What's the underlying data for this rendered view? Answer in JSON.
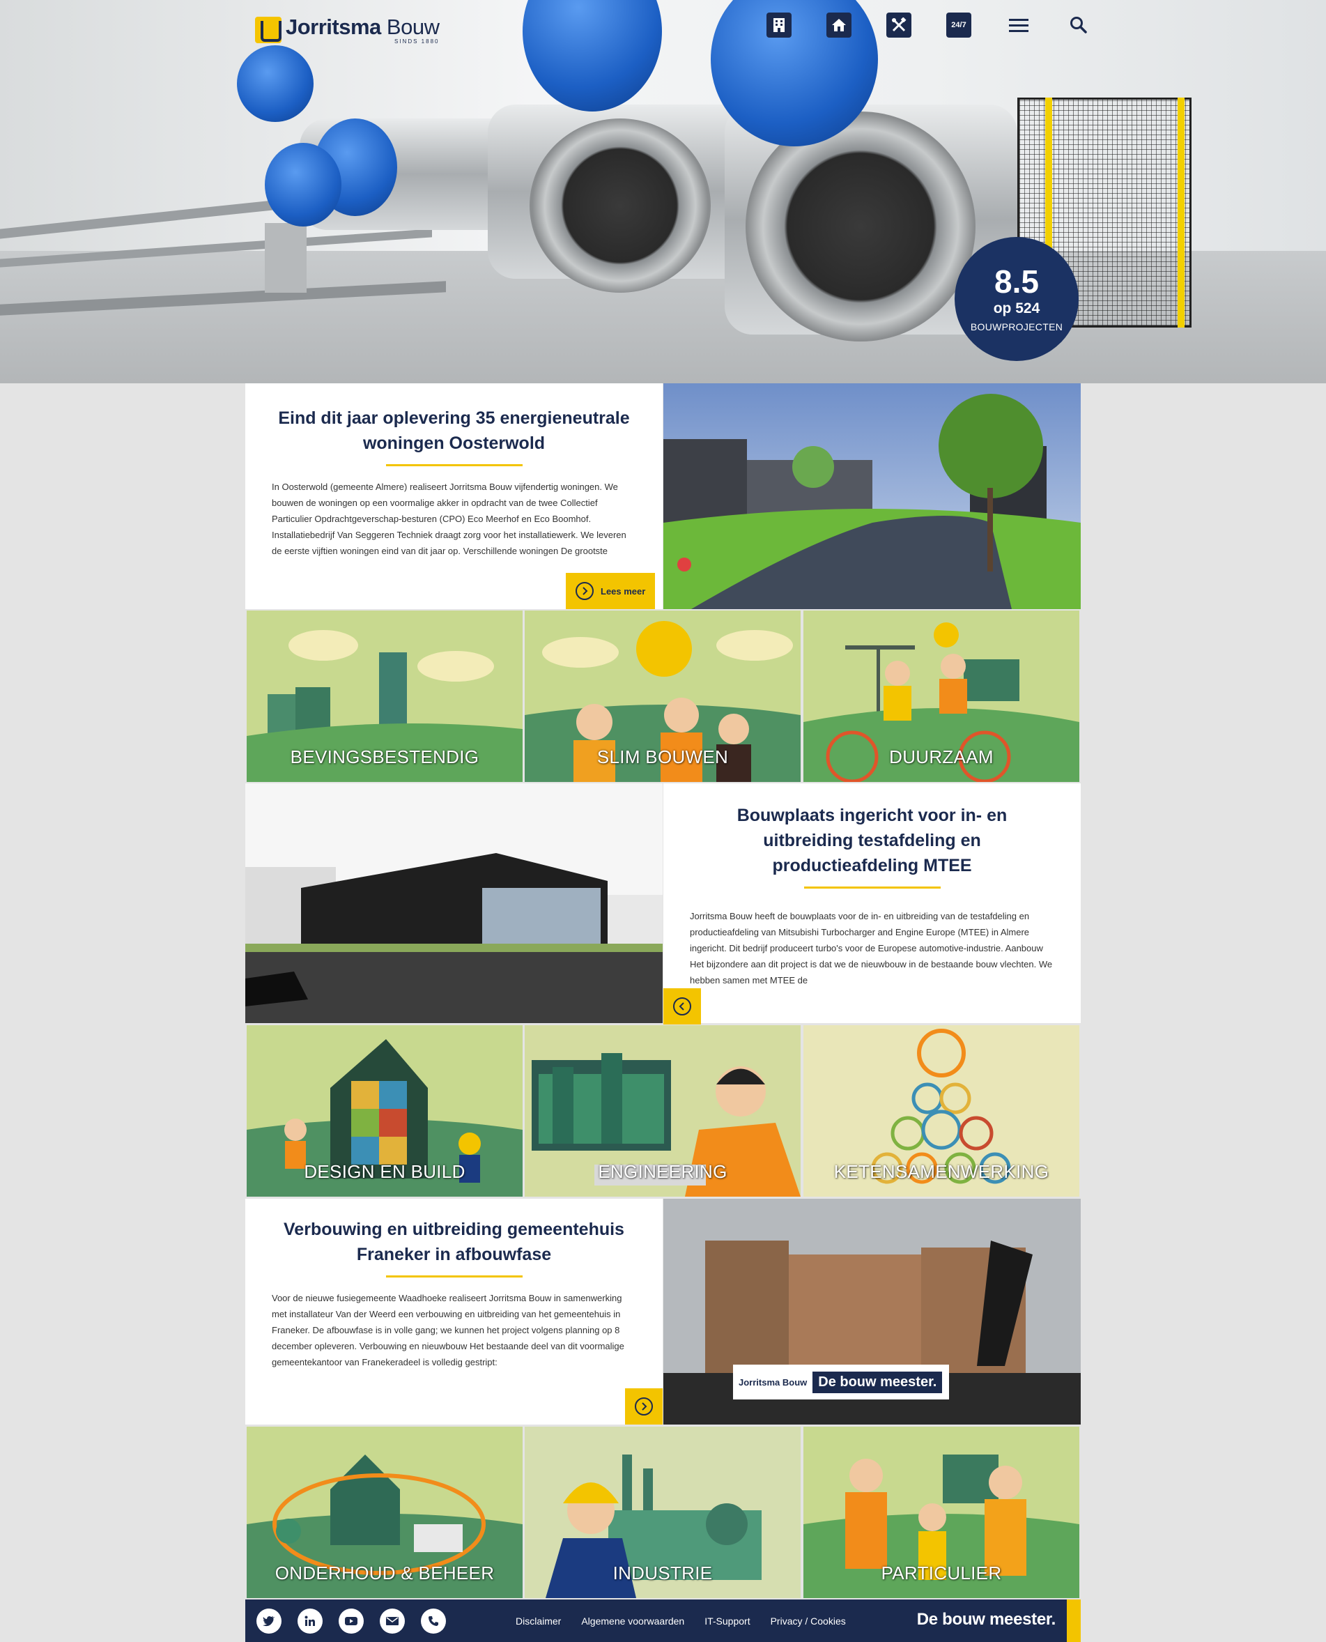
{
  "header": {
    "logo_name_bold": "Jorritsma",
    "logo_name_light": "Bouw",
    "logo_since": "SINDS 1880",
    "nav_icons": [
      "building-icon",
      "home-icon",
      "tools-icon",
      "24-7-icon",
      "menu-icon",
      "search-icon"
    ],
    "nav_247_label": "24/7"
  },
  "rating": {
    "score": "8.5",
    "count": "op 524",
    "label": "BOUWPROJECTEN"
  },
  "articles": [
    {
      "title": "Eind dit jaar oplevering 35 energieneutrale woningen Oosterwold",
      "body": "In Oosterwold (gemeente Almere) realiseert Jorritsma Bouw vijfendertig woningen. We bouwen de woningen op een voormalige akker in opdracht van de twee Collectief Particulier Opdrachtgeverschap-besturen (CPO) Eco Meerhof en Eco Boomhof. Installatiebedrijf Van Seggeren Techniek draagt zorg voor het installatiewerk. We leveren de eerste vijftien woningen eind van dit jaar op. Verschillende woningen De grootste",
      "read_more": "Lees meer"
    },
    {
      "title": "Bouwplaats ingericht voor in- en uitbreiding testafdeling en productieafdeling MTEE",
      "body": "Jorritsma Bouw heeft de bouwplaats voor de in- en uitbreiding van de testafdeling en productieafdeling van Mitsubishi Turbocharger and Engine Europe (MTEE) in Almere ingericht. Dit bedrijf produceert turbo's voor de Europese automotive-industrie. Aanbouw Het bijzondere aan dit project is dat we de nieuwbouw in de bestaande bouw vlechten. We hebben samen met MTEE de"
    },
    {
      "title": "Verbouwing en uitbreiding gemeentehuis Franeker in afbouwfase",
      "body": "Voor de nieuwe fusiegemeente Waadhoeke realiseert Jorritsma Bouw in samenwerking met installateur Van der Weerd een verbouwing en uitbreiding van het gemeentehuis in Franeker. De afbouwfase is in volle gang; we kunnen het project volgens planning op 8 december opleveren. Verbouwing en nieuwbouw Het bestaande deel van dit voormalige gemeentekantoor van Franekeradeel is volledig gestript:"
    }
  ],
  "photo_signage": {
    "banner_brand": "Jorritsma Bouw",
    "banner_slogan": "De bouw meester."
  },
  "tiles_row1": [
    "BEVINGSBESTENDIG",
    "SLIM BOUWEN",
    "DUURZAAM"
  ],
  "tiles_row2": [
    "DESIGN EN BUILD",
    "ENGINEERING",
    "KETENSAMENWERKING"
  ],
  "tiles_row3": [
    "ONDERHOUD & BEHEER",
    "INDUSTRIE",
    "PARTICULIER"
  ],
  "footer": {
    "social": [
      "twitter-icon",
      "linkedin-icon",
      "youtube-icon",
      "mail-icon",
      "phone-icon"
    ],
    "links": [
      "Disclaimer",
      "Algemene voorwaarden",
      "IT-Support",
      "Privacy / Cookies"
    ],
    "slogan": "De bouw meester."
  },
  "colors": {
    "navy": "#1b2a4e",
    "yellow": "#f3c400",
    "badge": "#1b3263",
    "page_bg": "#e4e4e4"
  }
}
